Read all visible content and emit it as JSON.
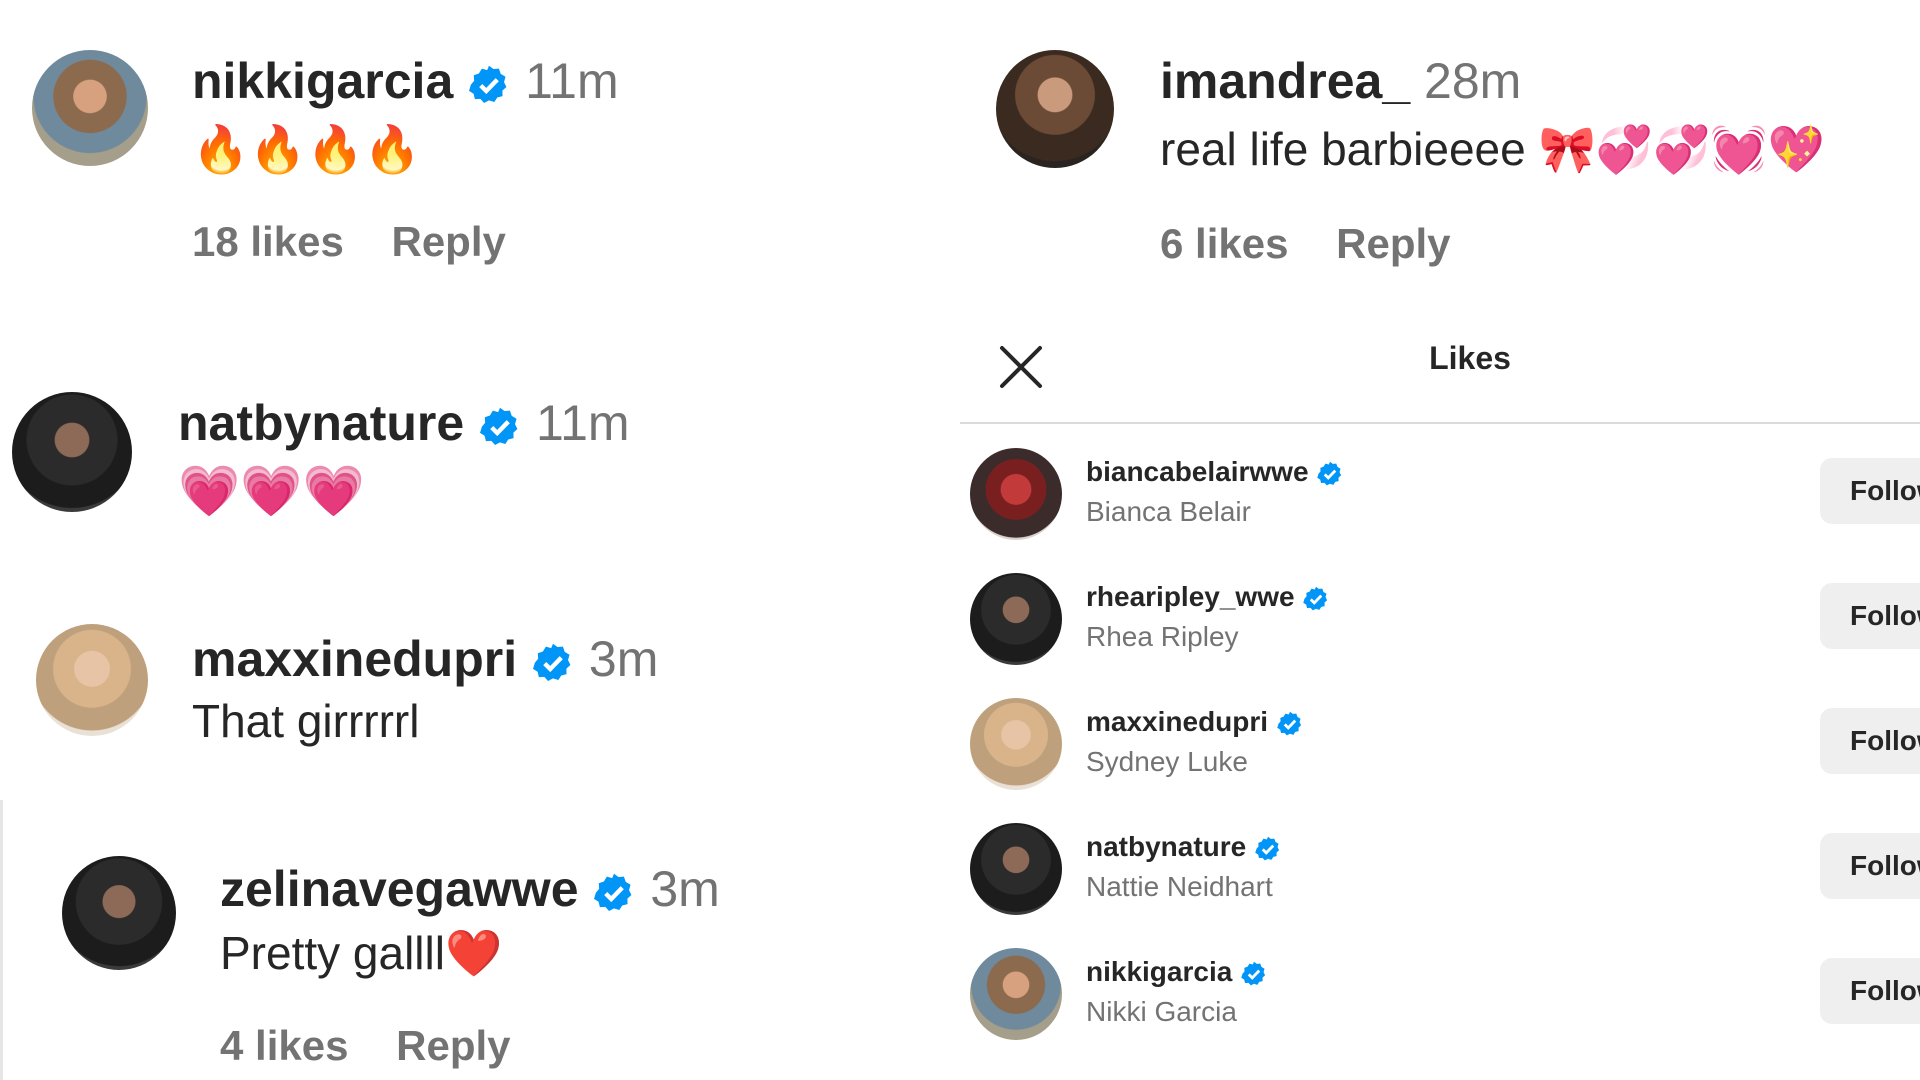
{
  "comments": [
    {
      "username": "nikkigarcia",
      "time": "11m",
      "text": "🔥🔥🔥🔥",
      "likes": "18 likes",
      "reply": "Reply"
    },
    {
      "username": "imandrea_",
      "time": "28m",
      "text": "real life barbieeee 🎀💞💞💓💖",
      "likes": "6 likes",
      "reply": "Reply"
    },
    {
      "username": "natbynature",
      "time": "11m",
      "text": "💗💗💗"
    },
    {
      "username": "maxxinedupri",
      "time": "3m",
      "text": "That girrrrrl"
    },
    {
      "username": "zelinavegawwe",
      "time": "3m",
      "text": "Pretty gallll❤️",
      "likes": "4 likes",
      "reply": "Reply"
    }
  ],
  "likes_panel": {
    "title": "Likes",
    "follow_label": "Follow",
    "users": [
      {
        "username": "biancabelairwwe",
        "name": "Bianca Belair"
      },
      {
        "username": "rhearipley_wwe",
        "name": "Rhea Ripley"
      },
      {
        "username": "maxxinedupri",
        "name": "Sydney Luke"
      },
      {
        "username": "natbynature",
        "name": "Nattie Neidhart"
      },
      {
        "username": "nikkigarcia",
        "name": "Nikki Garcia"
      }
    ]
  },
  "colors": {
    "verified": "#0095f6",
    "text": "#262626",
    "secondary": "#737373",
    "button_bg": "#efefef",
    "divider": "#dbdbdb"
  }
}
